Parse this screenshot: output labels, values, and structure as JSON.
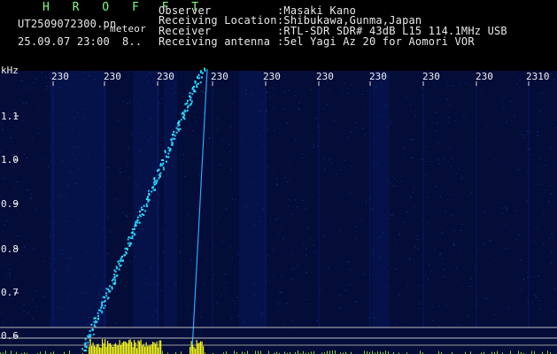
{
  "app": {
    "title": "H R O F F T",
    "filename": "UT2509072300.pn",
    "mode": "meteor",
    "datetime": "25.09.07 23:00",
    "counter": "8.."
  },
  "info": {
    "observer_label": "Observer",
    "observer_value": ":Masaki Kano",
    "location_label": "Receiving Location",
    "location_value": ":Shibukawa,Gunma,Japan",
    "receiver_label": "Receiver",
    "receiver_value": ":RTL-SDR SDR# 43dB L15 114.1MHz USB",
    "antenna_label": "Receiving antenna",
    "antenna_value": ":5el Yagi Az 20 for Aomori VOR"
  },
  "axis": {
    "unit": "kHz",
    "y_ticks": [
      "1.1",
      "1.0",
      "0.9",
      "0.8",
      "0.7",
      "0.6"
    ],
    "x_ticks": [
      "230",
      "230",
      "230",
      "230",
      "230",
      "230",
      "230",
      "230",
      "230",
      "2310"
    ]
  },
  "colors": {
    "background": "#000000",
    "waterfall_noise": "#0a1a7a",
    "meteor_trace": "#33e0ff",
    "audio_level": "#f2f21a",
    "title_green": "#7dfc7d"
  }
}
